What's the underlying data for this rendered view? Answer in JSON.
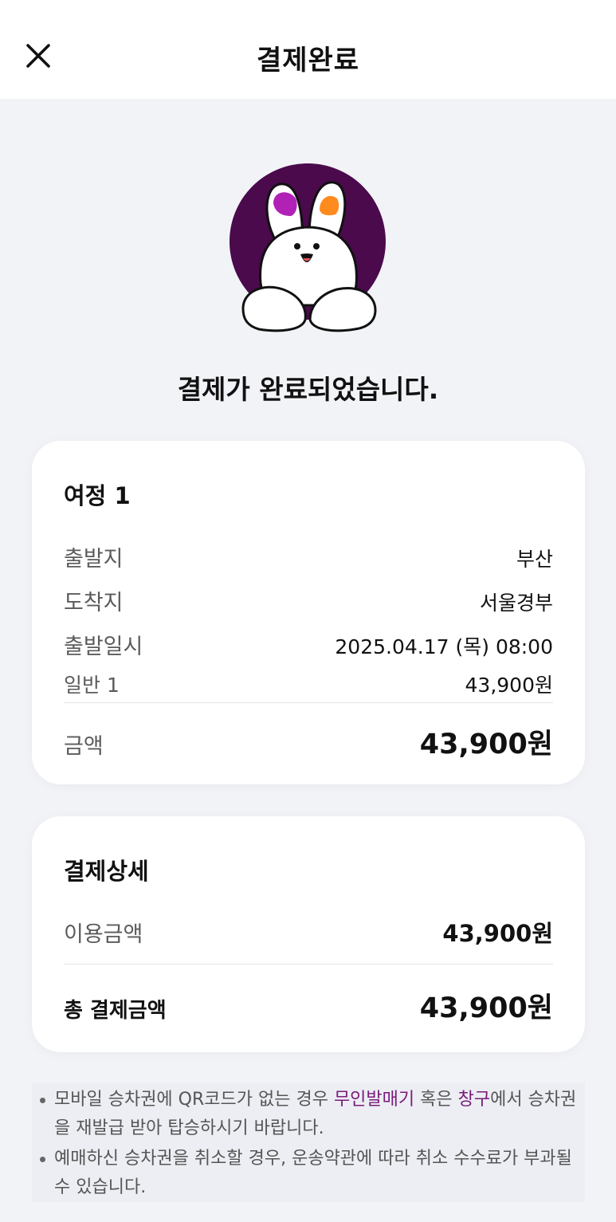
{
  "header": {
    "title": "결제완료",
    "close_icon": "close-icon"
  },
  "mascot": {
    "icon": "rabbit-mascot-icon",
    "bg_color": "#4a0a4c",
    "ear_left_color": "#b121b6",
    "ear_right_color": "#ff8a1e"
  },
  "message": "결제가 완료되었습니다.",
  "trip": {
    "title": "여정 1",
    "rows": [
      {
        "label": "출발지",
        "value": "부산"
      },
      {
        "label": "도착지",
        "value": "서울경부"
      },
      {
        "label": "출발일시",
        "value": "2025.04.17 (목) 08:00"
      },
      {
        "label": "일반 1",
        "value": "43,900원"
      }
    ],
    "amount_label": "금액",
    "amount_value": "43,900원"
  },
  "payment": {
    "title": "결제상세",
    "usage_label": "이용금액",
    "usage_value": "43,900원",
    "total_label": "총 결제금액",
    "total_value": "43,900원"
  },
  "notices": [
    {
      "parts": [
        "모바일 승차권에 QR코드가 없는 경우 ",
        "무인발매기",
        " 혹은 ",
        "창구",
        "에서 승차권을 재발급 받아 탑승하시기 바랍니다."
      ]
    },
    {
      "text": "예매하신 승차권을 취소할 경우, 운송약관에 따라 취소 수수료가 부과될 수 있습니다."
    }
  ],
  "colors": {
    "accent": "#7a1a7a",
    "background": "#f2f3f7"
  }
}
